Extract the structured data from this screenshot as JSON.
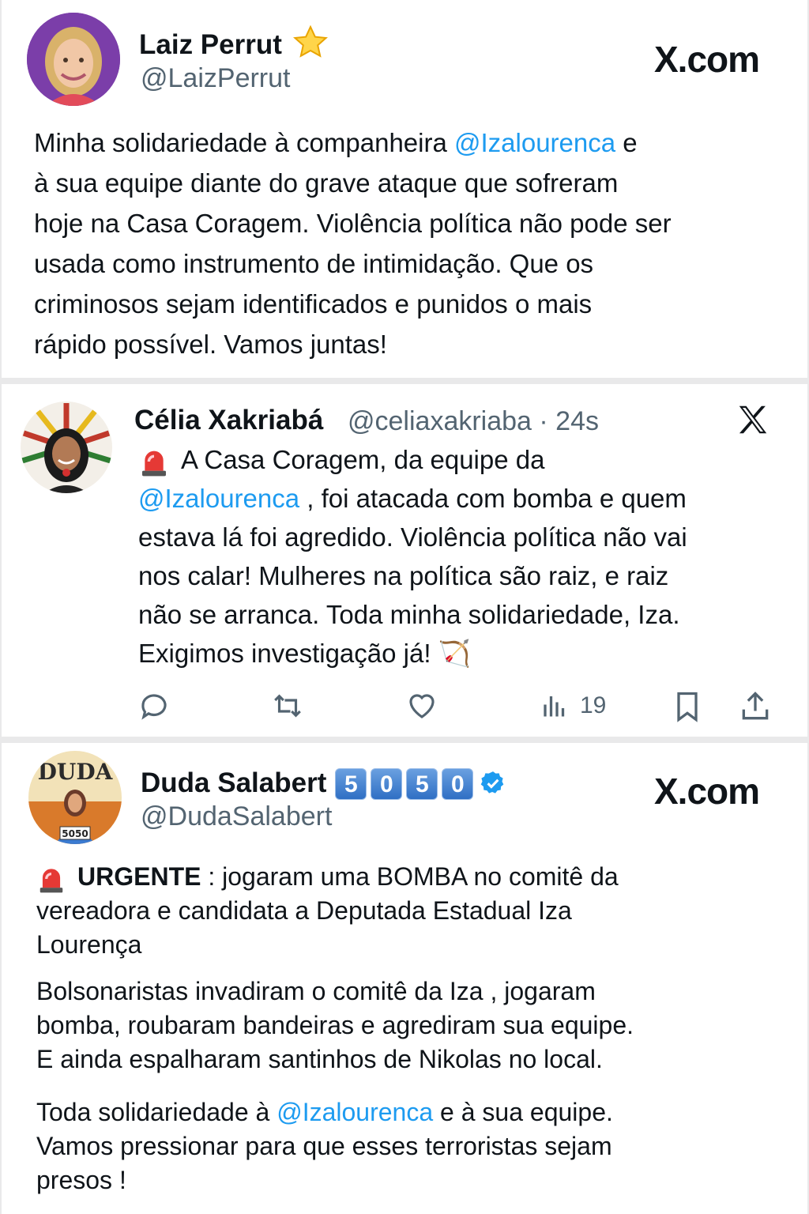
{
  "post1": {
    "name": "Laiz Perrut",
    "handle": "@LaizPerrut",
    "brand": "X.com",
    "text_a": "Minha solidariedade à companheira ",
    "mention": "@Izalourenca",
    "text_b": " e",
    "line2": "à sua equipe diante do grave ataque que sofreram",
    "line3": "hoje na Casa Coragem. Violência política não pode ser",
    "line4": "usada como instrumento de intimidação. Que os",
    "line5": "criminosos sejam identificados e punidos o mais",
    "line6": "rápido possível. Vamos juntas!"
  },
  "post2": {
    "name": "Célia Xakriabá",
    "handle_time": "@celiaxakriaba · 24s",
    "line1": "A Casa Coragem, da equipe da",
    "mention": "@Izalourenca",
    "line2_rest": " , foi atacada com bomba e quem",
    "line3": "estava lá foi agredido. Violência política não vai",
    "line4": "nos calar! Mulheres na política são raiz, e raiz",
    "line5": "não se arranca. Toda minha solidariedade, Iza.",
    "line6": "Exigimos investigação já! ",
    "bow_emoji": "🏹",
    "views": "19"
  },
  "post3": {
    "name": "Duda Salabert",
    "badges": [
      "5",
      "0",
      "5",
      "0"
    ],
    "handle": "@DudaSalabert",
    "brand": "X.com",
    "avatar_text": "DUDA",
    "avatar_number": "5050",
    "urgent": "URGENTE",
    "p1_line1_rest": " : jogaram uma BOMBA no comitê da",
    "p1_line2": "vereadora e candidata a Deputada Estadual Iza",
    "p1_line3": "Lourença",
    "p2_line1": "Bolsonaristas invadiram o comitê da Iza , jogaram",
    "p2_line2": "bomba, roubaram bandeiras e agrediram sua equipe.",
    "p2_line3": "E ainda espalharam santinhos de Nikolas no local.",
    "p3_line1_a": "Toda solidariedade à ",
    "mention": "@Izalourenca",
    "p3_line1_b": " e à sua equipe.",
    "p3_line2": "Vamos pressionar para que esses terroristas sejam",
    "p3_line3": "presos !"
  },
  "colors": {
    "link": "#1d9bf0",
    "text": "#0f1419",
    "muted": "#536471",
    "verified": "#1d9bf0"
  },
  "icons": [
    "star-icon",
    "x-logo-icon",
    "siren-icon",
    "reply-icon",
    "retweet-icon",
    "like-icon",
    "views-icon",
    "bookmark-icon",
    "share-icon",
    "verified-badge-icon"
  ]
}
